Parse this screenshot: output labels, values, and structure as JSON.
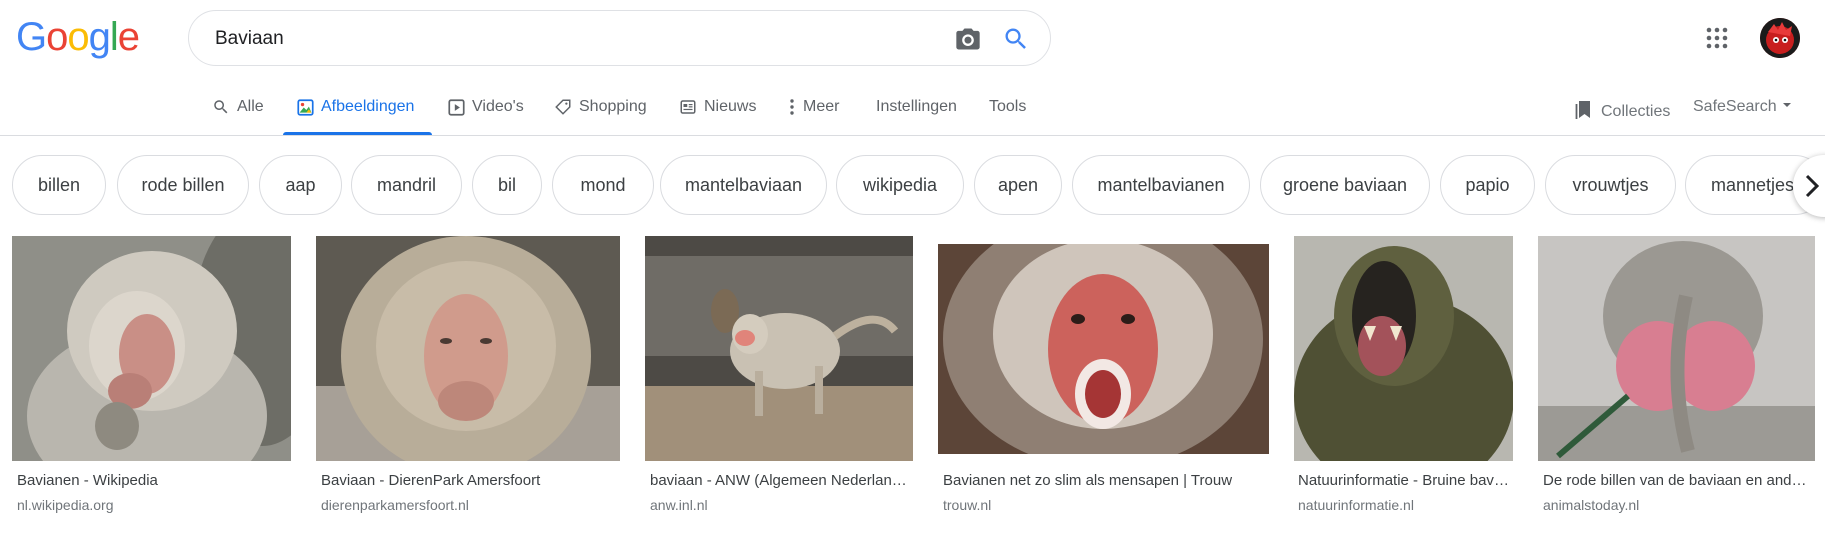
{
  "logo": {
    "text": "Google",
    "letters": [
      "G",
      "o",
      "o",
      "g",
      "l",
      "e"
    ],
    "colors": [
      "#4285f4",
      "#ea4335",
      "#fbbc05",
      "#4285f4",
      "#34a853",
      "#ea4335"
    ]
  },
  "search": {
    "query": "Baviaan"
  },
  "icons": {
    "camera": "camera-icon",
    "search": "search-icon",
    "apps": "apps-grid-icon"
  },
  "tabs": [
    {
      "label": "Alle",
      "icon": "search-icon",
      "active": false
    },
    {
      "label": "Afbeeldingen",
      "icon": "image-icon",
      "active": true
    },
    {
      "label": "Video's",
      "icon": "video-icon",
      "active": false
    },
    {
      "label": "Shopping",
      "icon": "tag-icon",
      "active": false
    },
    {
      "label": "Nieuws",
      "icon": "news-icon",
      "active": false
    },
    {
      "label": "Meer",
      "icon": "more-vert-icon",
      "active": false
    },
    {
      "label": "Instellingen",
      "active": false
    },
    {
      "label": "Tools",
      "active": false
    }
  ],
  "right_tools": {
    "collections": "Collecties",
    "safesearch": "SafeSearch"
  },
  "chips": [
    "billen",
    "rode billen",
    "aap",
    "mandril",
    "bil",
    "mond",
    "mantelbaviaan",
    "wikipedia",
    "apen",
    "mantelbavianen",
    "groene baviaan",
    "papio",
    "vrouwtjes",
    "mannetjes"
  ],
  "results": [
    {
      "title": "Bavianen - Wikipedia",
      "source": "nl.wikipedia.org"
    },
    {
      "title": "Baviaan - DierenPark Amersfoort",
      "source": "dierenparkamersfoort.nl"
    },
    {
      "title": "baviaan - ANW (Algemeen Nederlands Woordenboek)",
      "source": "anw.inl.nl"
    },
    {
      "title": "Bavianen net zo slim als mensapen | Trouw",
      "source": "trouw.nl"
    },
    {
      "title": "Natuurinformatie - Bruine baviaan",
      "source": "natuurinformatie.nl"
    },
    {
      "title": "De rode billen van de baviaan en andere dieren",
      "source": "animalstoday.nl"
    }
  ],
  "colors": {
    "accent": "#1a73e8",
    "text": "#202124",
    "muted": "#70757a"
  }
}
